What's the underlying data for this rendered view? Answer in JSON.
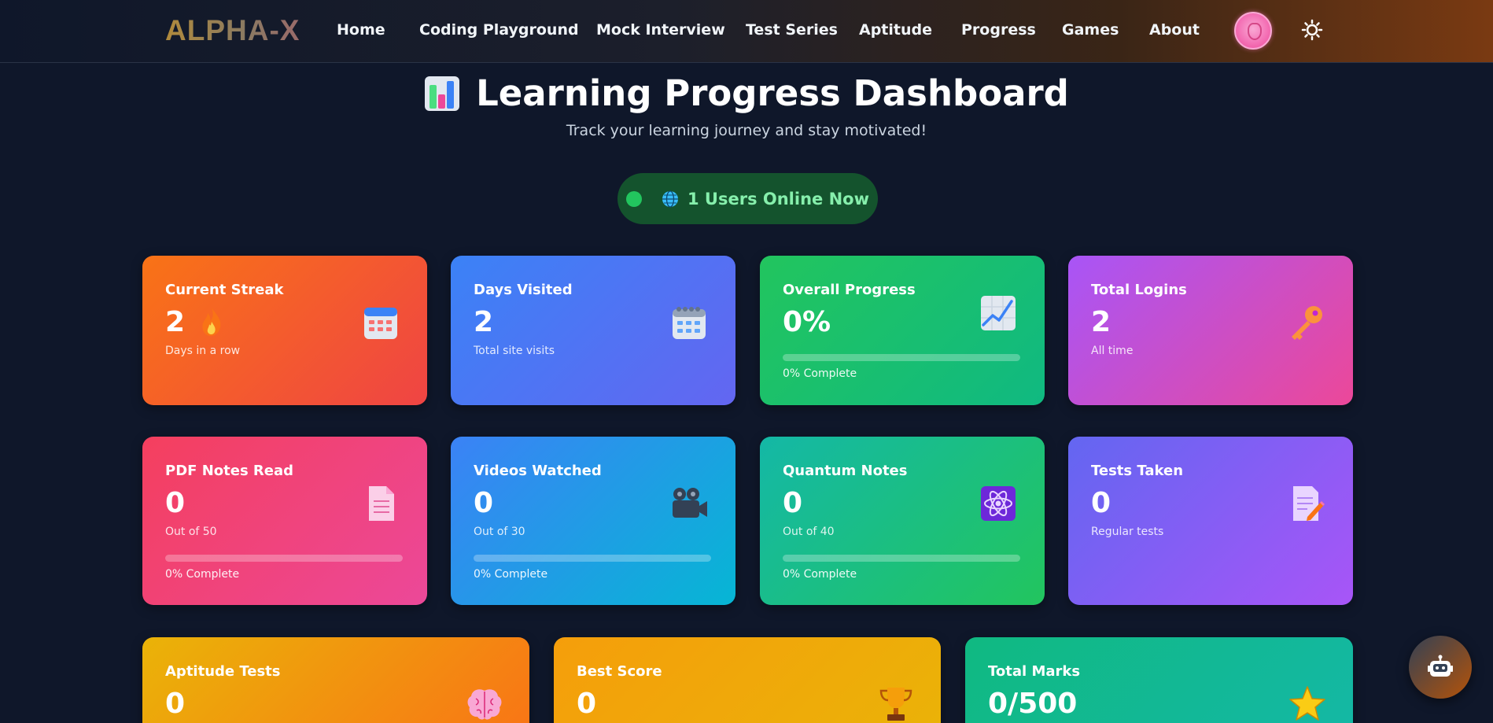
{
  "nav": {
    "logo": "ALPHA-X",
    "links": [
      "Home",
      "Coding Playground",
      "Mock Interview",
      "Test Series",
      "Aptitude",
      "Progress",
      "Games",
      "About"
    ]
  },
  "header": {
    "title": "Learning Progress Dashboard",
    "subtitle": "Track your learning journey and stay motivated!",
    "online": "1 Users Online Now"
  },
  "cards": [
    {
      "label": "Current Streak",
      "value": "2",
      "sub": "Days in a row",
      "icon": "calendar-icon"
    },
    {
      "label": "Days Visited",
      "value": "2",
      "sub": "Total site visits",
      "icon": "spiral-calendar-icon"
    },
    {
      "label": "Overall Progress",
      "value": "0%",
      "progress": 0,
      "progress_text": "0% Complete",
      "icon": "chart-increasing-icon"
    },
    {
      "label": "Total Logins",
      "value": "2",
      "sub": "All time",
      "icon": "key-icon"
    },
    {
      "label": "PDF Notes Read",
      "value": "0",
      "sub": "Out of 50",
      "progress": 0,
      "progress_text": "0% Complete",
      "icon": "document-icon"
    },
    {
      "label": "Videos Watched",
      "value": "0",
      "sub": "Out of 30",
      "progress": 0,
      "progress_text": "0% Complete",
      "icon": "movie-camera-icon"
    },
    {
      "label": "Quantum Notes",
      "value": "0",
      "sub": "Out of 40",
      "progress": 0,
      "progress_text": "0% Complete",
      "icon": "atom-icon"
    },
    {
      "label": "Tests Taken",
      "value": "0",
      "sub": "Regular tests",
      "icon": "memo-icon"
    },
    {
      "label": "Aptitude Tests",
      "value": "0",
      "icon": "brain-icon"
    },
    {
      "label": "Best Score",
      "value": "0",
      "icon": "trophy-icon"
    },
    {
      "label": "Total Marks",
      "value": "0/500",
      "icon": "star-icon"
    }
  ],
  "colors": {
    "background": "#0f172a",
    "online_pill": "#14532d",
    "online_text": "#86efac"
  }
}
